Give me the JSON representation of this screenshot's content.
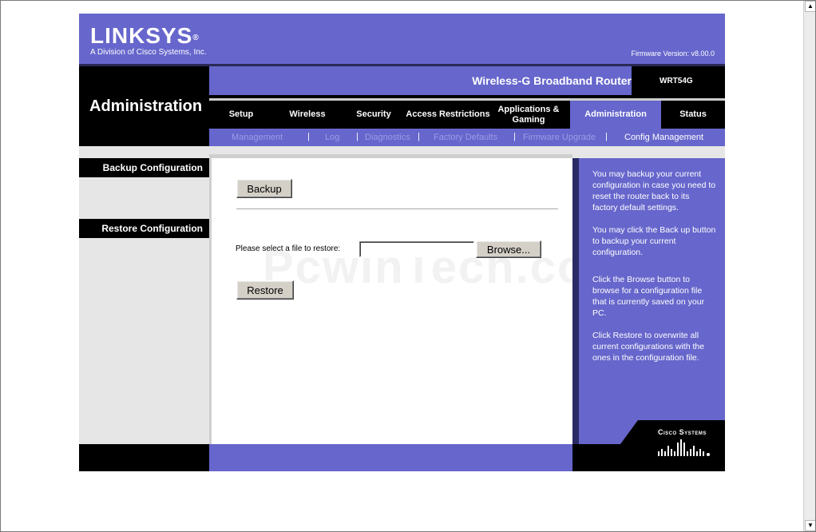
{
  "header": {
    "logo_text": "LINKSYS",
    "logo_reg": "®",
    "logo_subtitle": "A Division of Cisco Systems, Inc.",
    "firmware": "Firmware Version: v8.00.0"
  },
  "section_title": "Administration",
  "product_name": "Wireless-G Broadband Router",
  "model": "WRT54G",
  "tabs": [
    {
      "label": "Setup"
    },
    {
      "label": "Wireless"
    },
    {
      "label": "Security"
    },
    {
      "label": "Access Restrictions"
    },
    {
      "label": "Applications & Gaming"
    },
    {
      "label": "Administration"
    },
    {
      "label": "Status"
    }
  ],
  "subnav": [
    {
      "label": "Management"
    },
    {
      "label": "Log"
    },
    {
      "label": "Diagnostics"
    },
    {
      "label": "Factory Defaults"
    },
    {
      "label": "Firmware Upgrade"
    },
    {
      "label": "Config Management"
    }
  ],
  "subnav_separator": "|",
  "sidebar": {
    "backup_label": "Backup Configuration",
    "restore_label": "Restore Configuration"
  },
  "main": {
    "backup_button": "Backup",
    "file_prompt": "Please select a file to restore:",
    "file_value": "",
    "browse_button": "Browse...",
    "restore_button": "Restore"
  },
  "watermark": "PcwinTech.com",
  "help": [
    "You may backup your current configuration in case you need to reset the router back to its factory default settings.",
    "You may click the Back up button to backup your current configuration.",
    "Click the Browse button to browse for a configuration file that is currently saved on your PC.",
    "Click Restore to overwrite all current configurations with the ones in the configuration file."
  ],
  "cisco_logo": "Cisco Systems",
  "colors": {
    "brand_purple": "#6666cc",
    "black": "#000000",
    "inactive_subnav": "#9b9be8"
  }
}
